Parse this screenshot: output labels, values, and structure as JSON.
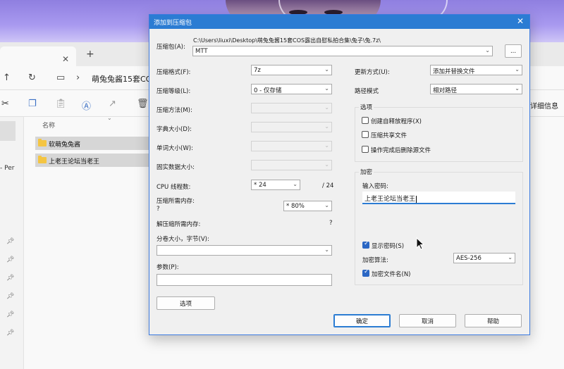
{
  "explorer": {
    "nav_title": "萌兔兔酱15套CO",
    "details_label": "详细信息",
    "sidebar_text": "- Per",
    "column_name": "名称",
    "files": [
      "软萌兔兔酱",
      "上老王论坛当老王"
    ]
  },
  "dialog": {
    "title": "添加到压缩包",
    "archive_label": "压缩包(A):",
    "archive_path": "C:\\Users\\liuxi\\Desktop\\萌兔兔酱15套COS露出自慰私拍合集\\兔子\\兔.7z\\",
    "archive_name": "MTT",
    "browse_label": "...",
    "left": {
      "format_label": "压缩格式(F):",
      "format_value": "7z",
      "level_label": "压缩等级(L):",
      "level_value": "0 - 仅存储",
      "method_label": "压缩方法(M):",
      "dict_label": "字典大小(D):",
      "word_label": "单词大小(W):",
      "solid_label": "固实数据大小:",
      "cpu_label": "CPU 线程数:",
      "cpu_value": "* 24",
      "cpu_total": "/ 24",
      "mem_label": "压缩所需内存:",
      "mem_sub": "?",
      "mem_value": "* 80%",
      "dmem_label": "解压缩所需内存:",
      "dmem_value": "?",
      "split_label": "分卷大小，字节(V):",
      "params_label": "参数(P):",
      "options_button": "选项"
    },
    "right": {
      "update_label": "更新方式(U):",
      "update_value": "添加并替换文件",
      "path_label": "路径模式",
      "path_value": "相对路径",
      "options_group": "选项",
      "opt_sfx": "创建自释放程序(X)",
      "opt_shared": "压缩共享文件",
      "opt_delete": "操作完成后删除源文件",
      "encrypt_group": "加密",
      "password_label": "输入密码:",
      "password_value": "上老王论坛当老王",
      "show_password": "显示密码(S)",
      "method_label": "加密算法:",
      "method_value": "AES-256",
      "encrypt_names": "加密文件名(N)"
    },
    "buttons": {
      "ok": "确定",
      "cancel": "取消",
      "help": "帮助"
    }
  }
}
